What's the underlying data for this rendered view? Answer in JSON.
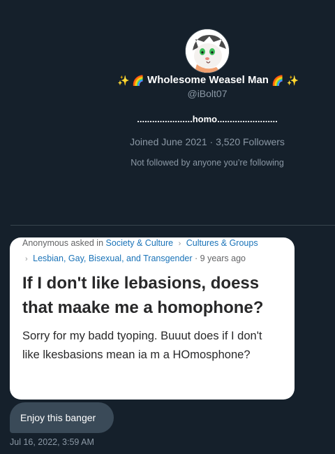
{
  "profile": {
    "display_name_prefix_emoji": "✨ 🌈",
    "display_name": "Wholesome Weasel Man",
    "display_name_suffix_emoji": "🌈 ✨",
    "handle": "@iBolt07",
    "bio": "......................homo........................",
    "joined": "Joined June 2021 · 3,520 Followers",
    "followed_by": "Not followed by anyone you’re following",
    "avatar_icon": "weasel-avatar-icon"
  },
  "question_card": {
    "asked_prefix": "Anonymous asked in",
    "topic_1": "Society & Culture",
    "topic_2": "Cultures & Groups",
    "topic_3": "Lesbian, Gay, Bisexual, and Transgender",
    "age": "· 9 years ago",
    "title": "If I don't like lebasions, doess that maake me a homophone?",
    "body": "Sorry for my badd tyoping. Buuut does if I don't like lkesbasions mean ia m a HOmosphone?"
  },
  "message": {
    "text": "Enjoy this banger",
    "timestamp": "Jul 16, 2022, 3:59 AM"
  },
  "colors": {
    "background": "#15202b",
    "bubble": "#3a4a58",
    "link": "#1a73b8",
    "muted": "#8b98a5"
  }
}
